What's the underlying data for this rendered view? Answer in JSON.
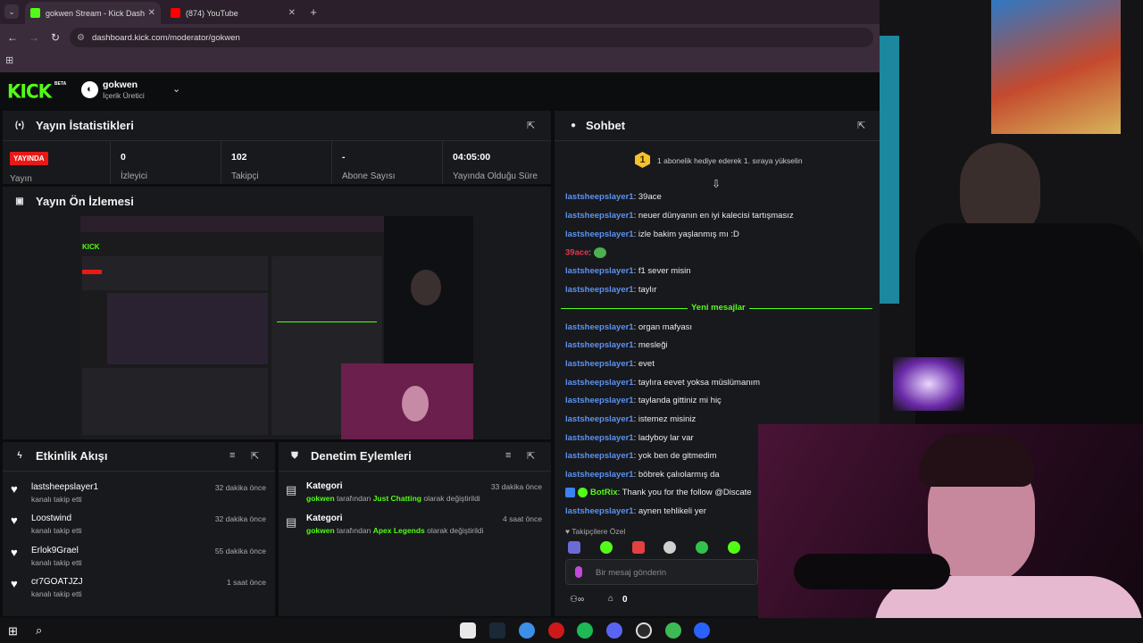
{
  "browser": {
    "tabs": [
      {
        "title": "gokwen Stream - Kick Dashboar",
        "active": true,
        "favicon_color": "#53fc18"
      },
      {
        "title": "(874) YouTube",
        "active": false,
        "favicon_color": "#ff0000"
      }
    ],
    "url": "dashboard.kick.com/moderator/gokwen"
  },
  "header": {
    "logo": "KICK",
    "beta": "BETA",
    "channel_name": "gokwen",
    "channel_role": "İçerik Üretici"
  },
  "stats": {
    "title": "Yayın İstatistikleri",
    "live_badge": "YAYINDA",
    "stream_label": "Yayın",
    "items": [
      {
        "value": "0",
        "label": "İzleyici"
      },
      {
        "value": "102",
        "label": "Takipçi"
      },
      {
        "value": "-",
        "label": "Abone Sayısı"
      },
      {
        "value": "04:05:00",
        "label": "Yayında Olduğu Süre"
      }
    ]
  },
  "preview": {
    "title": "Yayın Ön İzlemesi"
  },
  "events": {
    "title": "Etkinlik Akışı",
    "items": [
      {
        "name": "lastsheepslayer1",
        "sub": "kanalı takip etti",
        "time": "32 dakika önce"
      },
      {
        "name": "Loostwind",
        "sub": "kanalı takip etti",
        "time": "32 dakika önce"
      },
      {
        "name": "Erlok9Grael",
        "sub": "kanalı takip etti",
        "time": "55 dakika önce"
      },
      {
        "name": "cr7GOATJZJ",
        "sub": "kanalı takip etti",
        "time": "1 saat önce"
      }
    ]
  },
  "moderation": {
    "title": "Denetim Eylemleri",
    "items": [
      {
        "title": "Kategori",
        "user": "gokwen",
        "mid": "tarafından",
        "category": "Just Chatting",
        "tail": "olarak değiştirildi",
        "time": "33 dakika önce"
      },
      {
        "title": "Kategori",
        "user": "gokwen",
        "mid": "tarafından",
        "category": "Apex Legends",
        "tail": "olarak değiştirildi",
        "time": "4 saat önce"
      }
    ]
  },
  "chat": {
    "title": "Sohbet",
    "gift_badge": "1",
    "gift_text": "1 abonelik hediye ederek 1. sıraya yükselin",
    "new_messages_label": "Yeni mesajlar",
    "messages": [
      {
        "user": "lastsheepslayer1",
        "text": "39ace"
      },
      {
        "user": "lastsheepslayer1",
        "text": "neuer dünyanın en iyi kalecisi tartışmasız"
      },
      {
        "user": "lastsheepslayer1",
        "text": "izle bakim yaşlanmış mı :D"
      },
      {
        "user": "39ace",
        "text": ""
      },
      {
        "user": "lastsheepslayer1",
        "text": "f1 sever misin"
      },
      {
        "user": "lastsheepslayer1",
        "text": "taylır"
      },
      {
        "user": "lastsheepslayer1",
        "text": "organ mafyası"
      },
      {
        "user": "lastsheepslayer1",
        "text": "mesleği"
      },
      {
        "user": "lastsheepslayer1",
        "text": "evet"
      },
      {
        "user": "lastsheepslayer1",
        "text": "taylıra eevet yoksa müslümanım"
      },
      {
        "user": "lastsheepslayer1",
        "text": "taylanda gittiniz mi hiç"
      },
      {
        "user": "lastsheepslayer1",
        "text": "istemez misiniz"
      },
      {
        "user": "lastsheepslayer1",
        "text": "ladyboy lar var"
      },
      {
        "user": "lastsheepslayer1",
        "text": "yok ben de gitmedim"
      },
      {
        "user": "lastsheepslayer1",
        "text": "böbrek çalıolarmış da"
      },
      {
        "user": "BotRix",
        "text": "Thank you for the follow @Discate"
      },
      {
        "user": "lastsheepslayer1",
        "text": "aynen tehlikeli yer"
      }
    ],
    "followers_only": "Takipçilere Özel",
    "input_placeholder": "Bir mesaj gönderin",
    "infinity": "∞",
    "count": "0"
  }
}
